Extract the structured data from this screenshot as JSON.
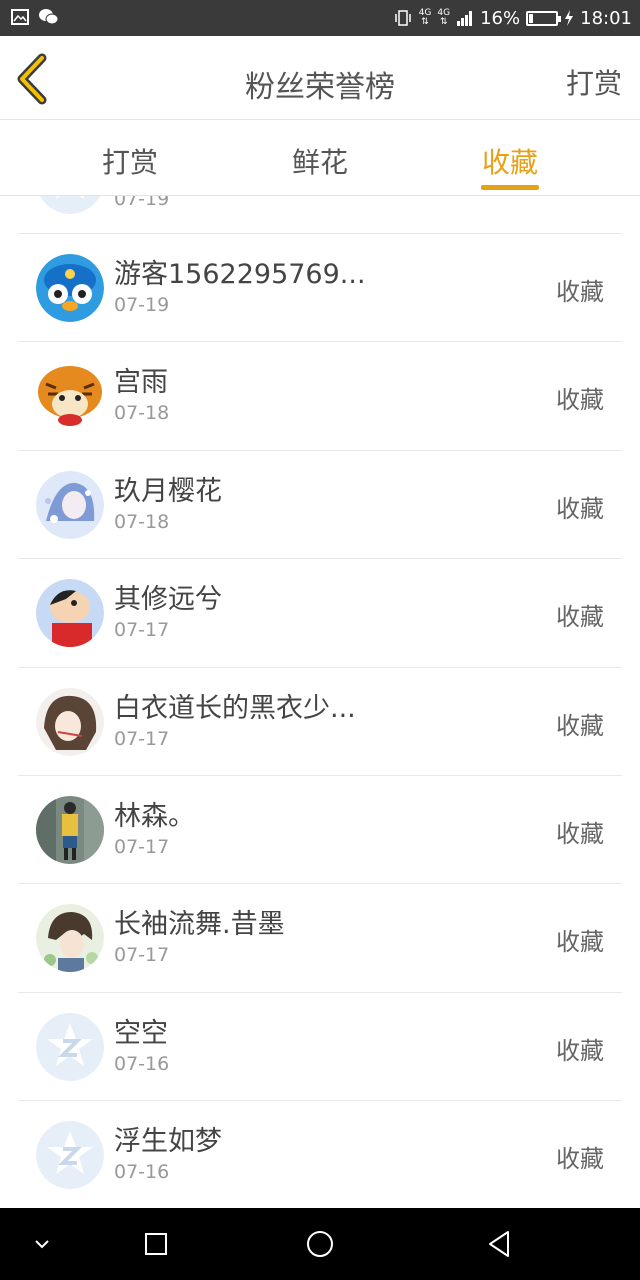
{
  "status_bar": {
    "network_1": "4G",
    "network_2": "4G",
    "battery_percent_text": "16%",
    "battery_level": 0.16,
    "time": "18:01"
  },
  "header": {
    "title": "粉丝荣誉榜",
    "action_label": "打赏"
  },
  "tabs": [
    {
      "label": "打赏",
      "active": false
    },
    {
      "label": "鲜花",
      "active": false
    },
    {
      "label": "收藏",
      "active": true
    }
  ],
  "accent_color": "#e6a117",
  "list": {
    "partial_row": {
      "date": "07-19",
      "avatar": "default-qq-icon"
    },
    "items": [
      {
        "name": "游客1562295769...",
        "date": "07-19",
        "action": "收藏",
        "avatar": "penguin-avatar"
      },
      {
        "name": "宫雨",
        "date": "07-18",
        "action": "收藏",
        "avatar": "tiger-avatar"
      },
      {
        "name": "玖月樱花",
        "date": "07-18",
        "action": "收藏",
        "avatar": "anime-girl-avatar"
      },
      {
        "name": "其修远兮",
        "date": "07-17",
        "action": "收藏",
        "avatar": "cartoon-boy-avatar"
      },
      {
        "name": "白衣道长的黑衣少...",
        "date": "07-17",
        "action": "收藏",
        "avatar": "illustrated-girl-avatar"
      },
      {
        "name": "林森。",
        "date": "07-17",
        "action": "收藏",
        "avatar": "photo-person-avatar"
      },
      {
        "name": "长袖流舞.昔墨",
        "date": "07-17",
        "action": "收藏",
        "avatar": "anime-boy-avatar"
      },
      {
        "name": "空空",
        "date": "07-16",
        "action": "收藏",
        "avatar": "default-qq-icon"
      },
      {
        "name": "浮生如梦",
        "date": "07-16",
        "action": "收藏",
        "avatar": "default-qq-icon"
      }
    ]
  }
}
